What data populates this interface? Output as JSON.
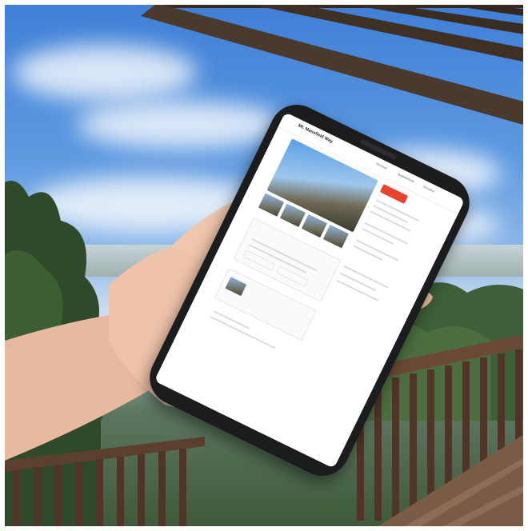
{
  "scene": {
    "description_free": true
  },
  "phone_screen": {
    "site_title": "Mt. Mansfield Way",
    "nav": [
      "Overview",
      "Neighborhood",
      "Schedule"
    ],
    "cta_label": "",
    "card_1_title": "",
    "card_2_label": ""
  },
  "colors": {
    "sky_top": "#3f7fd6",
    "accent": "#e8432f",
    "phone_body": "#1b1c1e"
  },
  "icons": [
    "pergola",
    "railing",
    "hand",
    "smartphone"
  ]
}
